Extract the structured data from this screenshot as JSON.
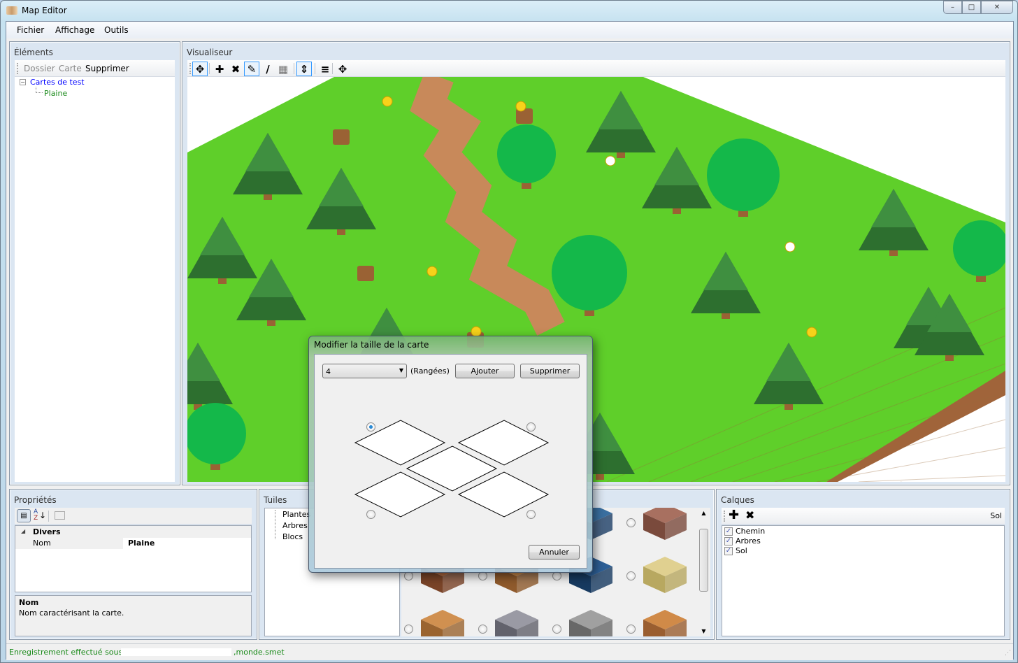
{
  "window": {
    "title": "Map Editor",
    "minimize": "–",
    "maximize": "□",
    "close": "✕"
  },
  "menu": [
    "Fichier",
    "Affichage",
    "Outils"
  ],
  "elements": {
    "title": "Éléments",
    "toolbar": [
      "Dossier",
      "Carte",
      "Supprimer"
    ],
    "tree": {
      "root": "Cartes de test",
      "expander": "−",
      "children": [
        "Plaine"
      ]
    }
  },
  "viewer": {
    "title": "Visualiseur",
    "tools": [
      "move-icon",
      "add-icon",
      "delete-icon",
      "pencil-icon",
      "brush-icon",
      "grid-icon",
      "resize-vertical-icon",
      "layers-icon",
      "pan-icon"
    ],
    "tool_glyphs": [
      "✥",
      "✚",
      "✖",
      "✎",
      "∕",
      "▦",
      "⇕",
      "≡",
      "✥"
    ],
    "selected_tools": [
      "move-icon",
      "pencil-icon",
      "resize-vertical-icon"
    ]
  },
  "properties": {
    "title": "Propriétés",
    "category": "Divers",
    "rows": [
      {
        "name": "Nom",
        "value": "Plaine"
      }
    ],
    "help_title": "Nom",
    "help_text": "Nom caractérisant la carte.",
    "toolbar_icons": [
      "categorized-icon",
      "alphabetical-icon",
      "property-pages-icon"
    ]
  },
  "tiles": {
    "title": "Tuiles",
    "tree": [
      "Plantes",
      "Arbres",
      "Blocs"
    ]
  },
  "layers": {
    "title": "Calques",
    "current": "Sol",
    "items": [
      {
        "label": "Chemin",
        "checked": true
      },
      {
        "label": "Arbres",
        "checked": true
      },
      {
        "label": "Sol",
        "checked": true
      }
    ],
    "add_glyph": "✚",
    "delete_glyph": "✖"
  },
  "status": {
    "prefix": "Enregistrement effectué sous",
    "suffix": ",monde.smet",
    "color": "#1a8a1a"
  },
  "dialog": {
    "title": "Modifier la taille de la carte",
    "select_value": "4",
    "unit_label": "(Rangées)",
    "add_label": "Ajouter",
    "remove_label": "Supprimer",
    "cancel_label": "Annuler",
    "anchor_selected": "top-left"
  },
  "colors": {
    "grass": "#5fcf2a",
    "path": "#c8895a",
    "tree_dark": "#2d6f2f",
    "selection": "#3399ff"
  }
}
